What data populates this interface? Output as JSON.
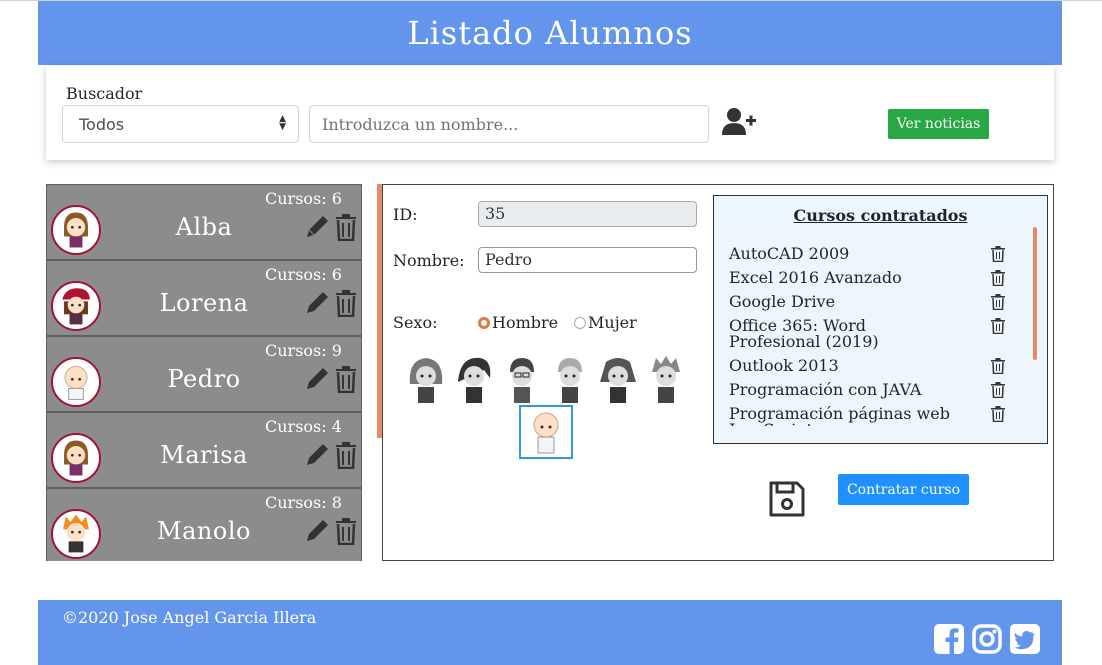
{
  "header": {
    "title": "Listado Alumnos"
  },
  "search": {
    "label": "Buscador",
    "filter_value": "Todos",
    "name_placeholder": "Introduzca un nombre...",
    "news_button": "Ver noticias"
  },
  "students": [
    {
      "courses_label": "Cursos: 6",
      "name": "Alba",
      "avatar": "girl-brown-hair-icon"
    },
    {
      "courses_label": "Cursos: 6",
      "name": "Lorena",
      "avatar": "girl-red-hat-icon"
    },
    {
      "courses_label": "Cursos: 9",
      "name": "Pedro",
      "avatar": "bald-boy-icon"
    },
    {
      "courses_label": "Cursos: 4",
      "name": "Marisa",
      "avatar": "girl-brown-hair-icon"
    },
    {
      "courses_label": "Cursos: 8",
      "name": "Manolo",
      "avatar": "boy-orange-hair-icon"
    }
  ],
  "detail": {
    "id_label": "ID:",
    "id_value": "35",
    "name_label": "Nombre:",
    "name_value": "Pedro",
    "sex_label": "Sexo:",
    "sex_options": [
      "Hombre",
      "Mujer"
    ],
    "sex_selected": "Hombre",
    "save_icon": "floppy-disk-icon",
    "contract_button": "Contratar curso"
  },
  "courses": {
    "title": "Cursos contratados",
    "items": [
      "AutoCAD 2009",
      "Excel 2016 Avanzado",
      "Google Drive",
      "Office 365: Word Profesional (2019)",
      "Outlook 2013",
      "Programación con JAVA",
      "Programación páginas web JavaScript"
    ]
  },
  "footer": {
    "copyright": "©2020 Jose Angel Garcia Illera",
    "social": [
      "facebook-icon",
      "instagram-icon",
      "twitter-icon"
    ]
  },
  "colors": {
    "header_blue": "#6495ed",
    "card_gray": "#8c8c8c",
    "accent_orange": "#e38c66",
    "green": "#28a745",
    "button_blue": "#1e90ff"
  }
}
